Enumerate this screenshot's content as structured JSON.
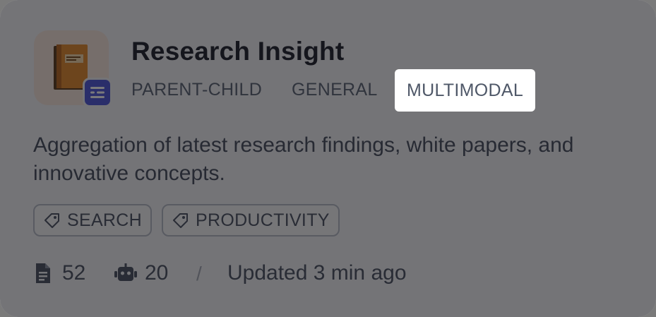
{
  "card": {
    "title": "Research Insight",
    "modes": [
      "PARENT-CHILD",
      "GENERAL",
      "MULTIMODAL"
    ],
    "highlighted_mode": "MULTIMODAL",
    "description": "Aggregation of latest research findings, white papers, and innovative concepts.",
    "tags": [
      "SEARCH",
      "PRODUCTIVITY"
    ],
    "stats": {
      "documents": "52",
      "agents": "20",
      "separator": "/",
      "updated": "Updated 3 min ago"
    },
    "icons": {
      "app": "book-icon",
      "badge": "list-icon",
      "tag": "tag-icon",
      "documents": "document-icon",
      "agents": "robot-icon"
    },
    "colors": {
      "badge": "#4d54d8",
      "card_bg": "#f4f4f6",
      "overlay": "#1010148f",
      "highlight_bg": "#ffffff"
    }
  }
}
